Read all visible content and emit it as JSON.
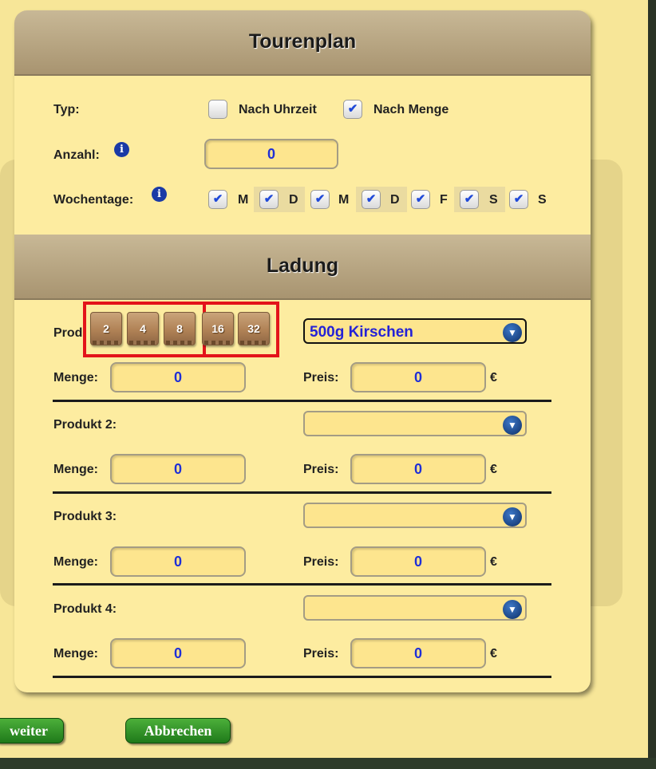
{
  "tourenplan": {
    "title": "Tourenplan",
    "typ_label": "Typ:",
    "type_options": [
      {
        "label": "Nach Uhrzeit",
        "checked": false
      },
      {
        "label": "Nach Menge",
        "checked": true
      }
    ],
    "anzahl_label": "Anzahl:",
    "anzahl_value": "0",
    "wochentage_label": "Wochentage:",
    "days": [
      {
        "letter": "M",
        "checked": true
      },
      {
        "letter": "D",
        "checked": true
      },
      {
        "letter": "M",
        "checked": true
      },
      {
        "letter": "D",
        "checked": true
      },
      {
        "letter": "F",
        "checked": true
      },
      {
        "letter": "S",
        "checked": true
      },
      {
        "letter": "S",
        "checked": true
      }
    ],
    "info_icon": "i",
    "check_glyph": "✔"
  },
  "ladung": {
    "title": "Ladung",
    "quantity_presets": [
      "2",
      "4",
      "8",
      "16",
      "32"
    ],
    "menge_label": "Menge:",
    "preis_label": "Preis:",
    "currency": "€",
    "products": [
      {
        "label": "Prod",
        "selected": "500g Kirschen",
        "menge": "0",
        "preis": "0"
      },
      {
        "label": "Produkt 2:",
        "selected": "",
        "menge": "0",
        "preis": "0"
      },
      {
        "label": "Produkt 3:",
        "selected": "",
        "menge": "0",
        "preis": "0"
      },
      {
        "label": "Produkt 4:",
        "selected": "",
        "menge": "0",
        "preis": "0"
      }
    ]
  },
  "buttons": {
    "weiter": "weiter",
    "abbrechen": "Abbrechen"
  },
  "colors": {
    "panel": "#fdeca0",
    "field": "#fde58e",
    "value_text": "#1f2fd6",
    "highlight": "#e3141a",
    "button": "#2e8f25"
  }
}
